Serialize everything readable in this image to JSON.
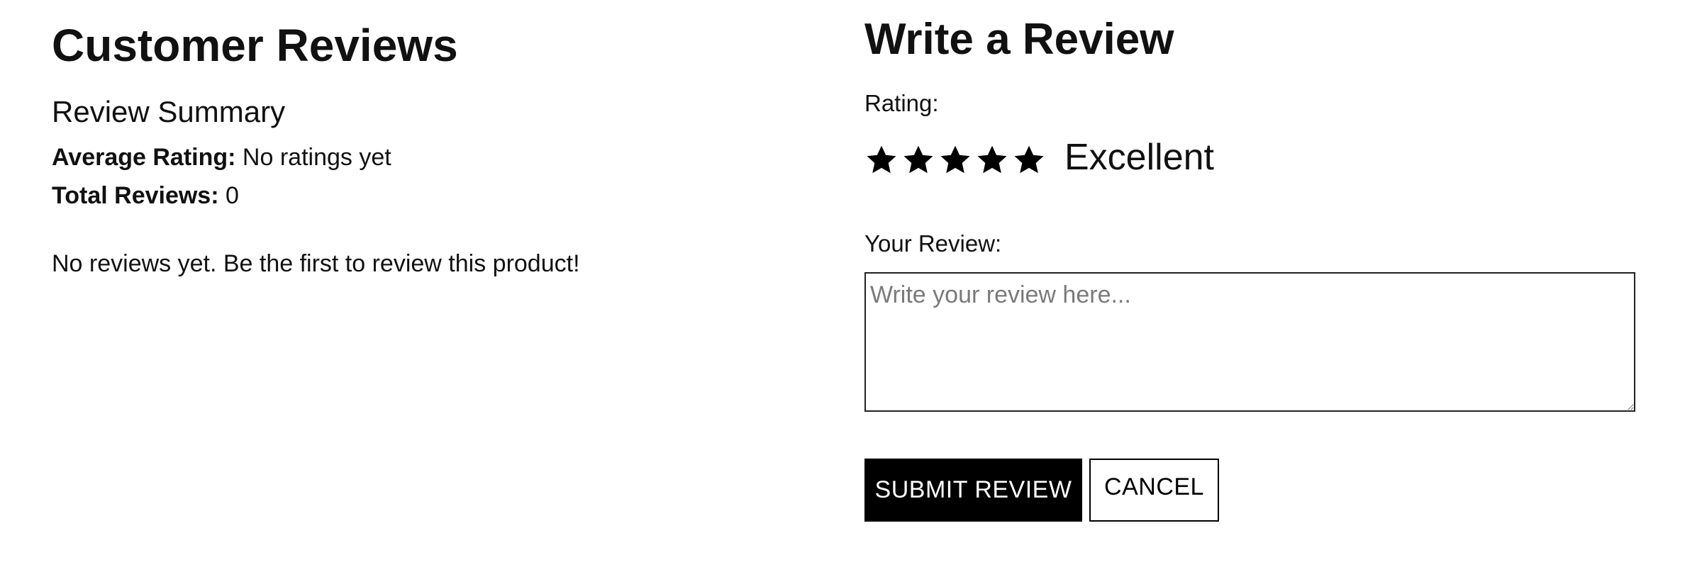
{
  "reviews_summary": {
    "title": "Customer Reviews",
    "subtitle": "Review Summary",
    "average_rating_label": "Average Rating:",
    "average_rating_value": "No ratings yet",
    "total_reviews_label": "Total Reviews:",
    "total_reviews_value": "0",
    "empty_message": "No reviews yet. Be the first to review this product!"
  },
  "write_review": {
    "title": "Write a Review",
    "rating_label": "Rating:",
    "rating": {
      "stars_filled": 5,
      "stars_total": 5,
      "rating_text": "Excellent",
      "star_icon": "star-icon",
      "star_color": "#000000"
    },
    "review_label": "Your Review:",
    "review_value": "",
    "review_placeholder": "Write your review here...",
    "submit_label": "SUBMIT REVIEW",
    "cancel_label": "CANCEL"
  },
  "colors": {
    "text": "#111111",
    "primary_button_bg": "#000000",
    "primary_button_text": "#ffffff",
    "border": "#222222",
    "placeholder": "#7a7a7a"
  }
}
